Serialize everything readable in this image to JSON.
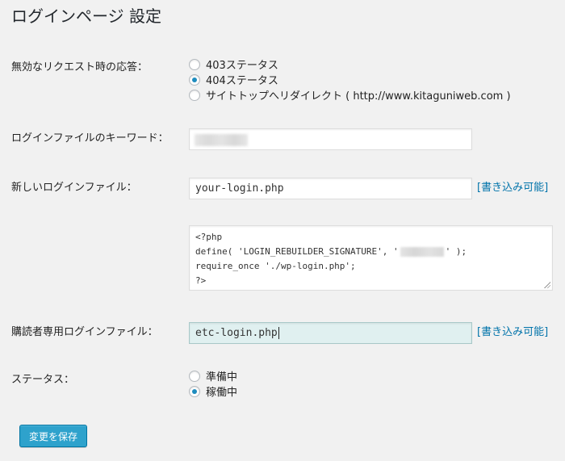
{
  "page": {
    "title": "ログインページ 設定"
  },
  "invalid_request": {
    "label": "無効なリクエスト時の応答：",
    "options": [
      {
        "label": "403ステータス",
        "checked": false
      },
      {
        "label": "404ステータス",
        "checked": true
      },
      {
        "label": "サイトトップへリダイレクト ( http://www.kitaguniweb.com )",
        "checked": false
      }
    ]
  },
  "login_keyword": {
    "label": "ログインファイルのキーワード：",
    "value": ""
  },
  "new_login_file": {
    "label": "新しいログインファイル：",
    "value": "your-login.php",
    "writable": "[書き込み可能]",
    "code_lines": [
      "<?php",
      "define( 'LOGIN_REBUILDER_SIGNATURE', '",
      "' );",
      "require_once './wp-login.php';",
      "?>"
    ]
  },
  "subscriber_login_file": {
    "label": "購読者専用ログインファイル：",
    "value": "etc-login.php",
    "writable": "[書き込み可能]"
  },
  "status": {
    "label": "ステータス：",
    "options": [
      {
        "label": "準備中",
        "checked": false
      },
      {
        "label": "稼働中",
        "checked": true
      }
    ]
  },
  "save_button": {
    "label": "変更を保存"
  },
  "colors": {
    "accent": "#2ea2cc",
    "link": "#0073aa",
    "background": "#f1f1f1"
  }
}
